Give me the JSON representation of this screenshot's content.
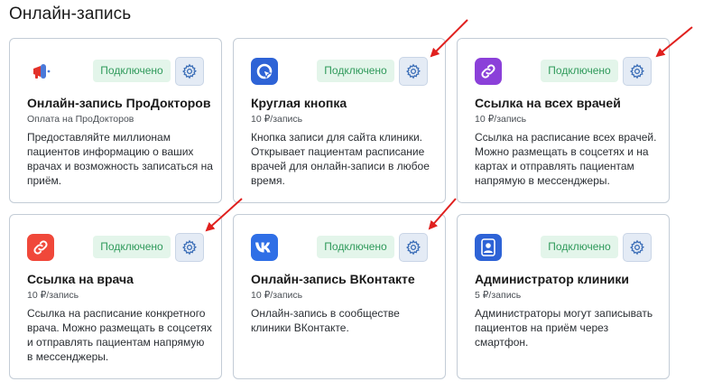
{
  "page": {
    "title": "Онлайн-запись"
  },
  "colors": {
    "badge_bg": "#e3f5ea",
    "badge_text": "#2f9a5b",
    "gear_bg": "#e4ebf5",
    "gear_icon": "#3d6fb8",
    "card_border": "#c3ccd6",
    "annotation_arrow": "#e0201e"
  },
  "cards": [
    {
      "icon": "megaphone-icon",
      "icon_color": "#ffffff",
      "status": "Подключено",
      "title": "Онлайн-запись ПроДокторов",
      "price": "Оплата на ПроДокторов",
      "description": "Предоставляйте миллионам пациентов информацию о ваших врачах и возможность записаться на приём."
    },
    {
      "icon": "cursor-circle-icon",
      "icon_color": "#2e63d6",
      "status": "Подключено",
      "title": "Круглая кнопка",
      "price": "10 ₽/запись",
      "description": "Кнопка записи для сайта клиники. Открывает пациентам расписание врачей для онлайн-записи в любое время."
    },
    {
      "icon": "link-icon",
      "icon_color": "#8b40d9",
      "status": "Подключено",
      "title": "Ссылка на всех врачей",
      "price": "10 ₽/запись",
      "description": "Ссылка на расписание всех врачей. Можно размещать в соцсетях и на картах и отправлять пациентам напрямую в мессенджеры."
    },
    {
      "icon": "link-icon",
      "icon_color": "#f0483a",
      "status": "Подключено",
      "title": "Ссылка на врача",
      "price": "10 ₽/запись",
      "description": "Ссылка на расписание конкретного врача. Можно размещать в соцсетях и отправлять пациентам напрямую в мессенджеры."
    },
    {
      "icon": "vk-icon",
      "icon_color": "#2f6fe6",
      "status": "Подключено",
      "title": "Онлайн-запись ВКонтакте",
      "price": "10 ₽/запись",
      "description": "Онлайн-запись в сообществе клиники ВКонтакте."
    },
    {
      "icon": "admin-person-icon",
      "icon_color": "#2e63d6",
      "status": "Подключено",
      "title": "Администратор клиники",
      "price": "5 ₽/запись",
      "description": "Администраторы могут записывать пациентов на приём через смартфон."
    }
  ]
}
